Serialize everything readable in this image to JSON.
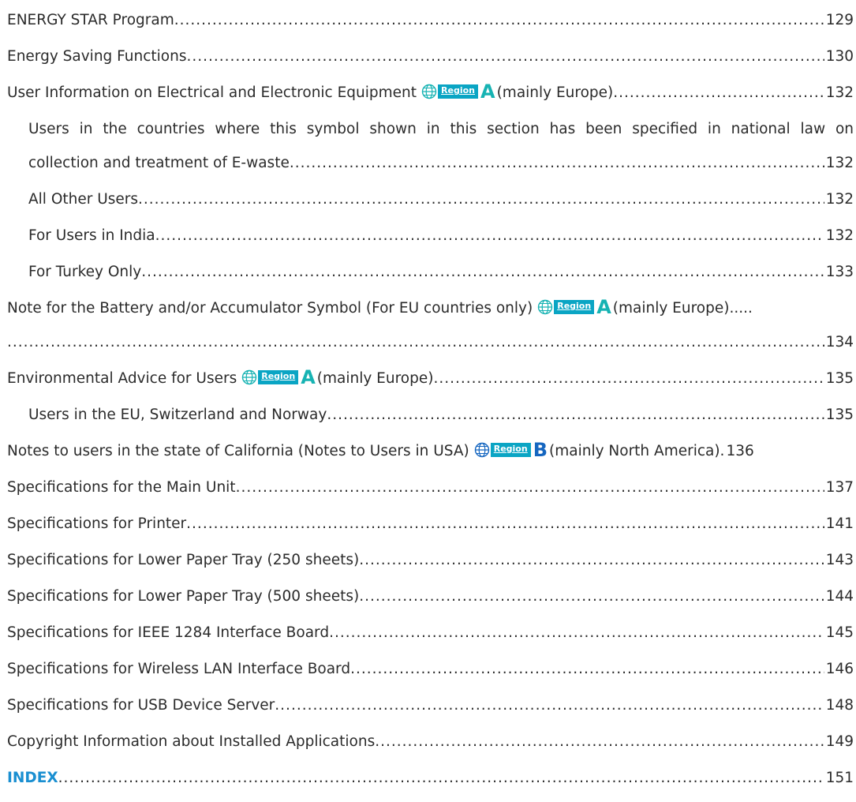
{
  "toc": {
    "energy_star": {
      "label": "ENERGY STAR Program",
      "page": "129"
    },
    "energy_saving": {
      "label": "Energy Saving Functions",
      "page": "130"
    },
    "user_info": {
      "label": "User Information on Electrical and Electronic Equipment",
      "region_label": "Region",
      "region_letter": "A",
      "suffix": "(mainly Europe)",
      "page": "132"
    },
    "users_countries": {
      "line1": "Users in the countries where this symbol shown in this section has been specified in national law on",
      "line2": "collection and treatment of E-waste",
      "page": "132"
    },
    "all_other": {
      "label": "All Other Users",
      "page": "132"
    },
    "india": {
      "label": "For Users in India",
      "page": "132"
    },
    "turkey": {
      "label": "For Turkey Only",
      "page": "133"
    },
    "battery": {
      "label": "Note for the Battery and/or Accumulator Symbol (For EU countries only)",
      "region_label": "Region",
      "region_letter": "A",
      "suffix": "(mainly Europe)",
      "page": "134"
    },
    "env_advice": {
      "label": "Environmental Advice for Users",
      "region_label": "Region",
      "region_letter": "A",
      "suffix": "(mainly Europe)",
      "page": "135"
    },
    "eu_users": {
      "label": "Users in the EU, Switzerland and Norway",
      "page": "135"
    },
    "california": {
      "label": "Notes to users in the state of California (Notes to Users in USA)",
      "region_label": "Region",
      "region_letter": "B",
      "suffix": "(mainly North America).",
      "page": "136"
    },
    "spec_main": {
      "label": "Specifications for the Main Unit",
      "page": "137"
    },
    "spec_printer": {
      "label": "Specifications for Printer",
      "page": "141"
    },
    "spec_250": {
      "label": "Specifications for Lower Paper Tray (250 sheets)",
      "page": "143"
    },
    "spec_500": {
      "label": "Specifications for Lower Paper Tray (500 sheets)",
      "page": "144"
    },
    "spec_ieee": {
      "label": "Specifications for IEEE 1284 Interface Board",
      "page": "145"
    },
    "spec_wlan": {
      "label": "Specifications for Wireless LAN Interface Board",
      "page": "146"
    },
    "spec_usb": {
      "label": "Specifications for USB Device Server",
      "page": "148"
    },
    "copyright": {
      "label": "Copyright Information about Installed Applications",
      "page": "149"
    },
    "index": {
      "label": "INDEX",
      "page": "151"
    }
  },
  "colors": {
    "region_badge": "#0aa5c4",
    "region_a": "#17b3b3",
    "region_b": "#1566c0",
    "index_link": "#1a8fd1"
  },
  "icons": {
    "region": "globe-icon"
  }
}
